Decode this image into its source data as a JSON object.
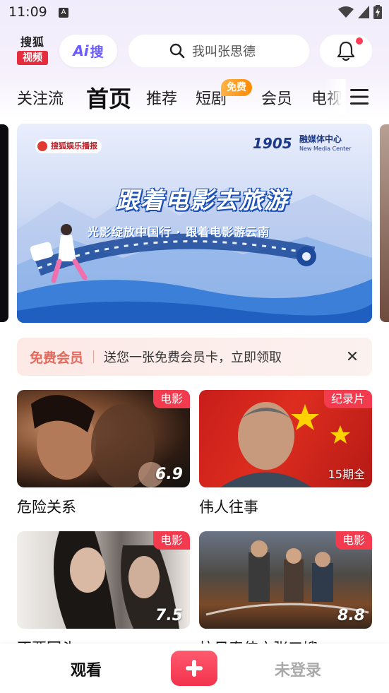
{
  "status_bar": {
    "time": "11:09",
    "notif_glyph": "A"
  },
  "header": {
    "logo_top": "搜狐",
    "logo_bottom": "视频",
    "ai_prefix": "Ai",
    "ai_label": "搜",
    "search_placeholder": "我叫张思德",
    "bell_has_dot": true
  },
  "tabs": [
    {
      "label": "关注流"
    },
    {
      "label": "首页",
      "active": true
    },
    {
      "label": "推荐"
    },
    {
      "label": "短剧",
      "badge": "免费"
    },
    {
      "label": "会员"
    },
    {
      "label": "电视"
    }
  ],
  "banner": {
    "badge_left": "搜狐娱乐播报",
    "logo_1905": "1905",
    "media_name": "融媒体中心",
    "media_sub": "New Media Center",
    "title": "跟着电影去旅游",
    "subtitle": "光影绽放中国行 · 跟着电影游云南"
  },
  "promo": {
    "tag": "免费会员",
    "text": "送您一张免费会员卡，立即领取"
  },
  "cards": [
    {
      "title": "危险关系",
      "badge": "电影",
      "score": "6.9"
    },
    {
      "title": "伟人往事",
      "badge": "纪录片",
      "episodes": "15期全"
    },
    {
      "title": "不要回头",
      "badge": "电影",
      "score": "7.5"
    },
    {
      "title": "抗日奇侠之张三嫂",
      "badge": "电影",
      "score": "8.8"
    }
  ],
  "bottom_nav": {
    "watch": "观看",
    "login": "未登录"
  },
  "colors": {
    "accent_red": "#f23b4f",
    "ai_purple": "#6a5cff",
    "promo_orange": "#e6695c"
  }
}
